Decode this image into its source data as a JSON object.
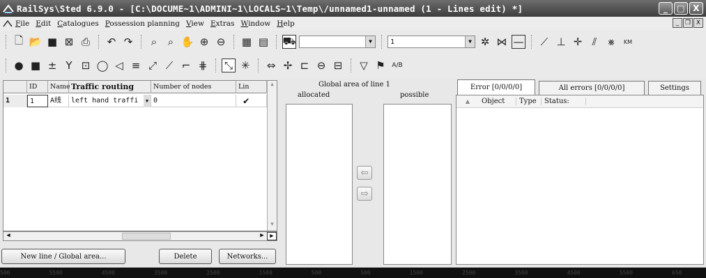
{
  "window": {
    "title": "RailSys\\Sted 6.9.0 - [C:\\DOCUME~1\\ADMINI~1\\LOCALS~1\\Temp\\/unnamed1-unnamed (1 - Lines edit) *]",
    "buttons": {
      "minimize": "_",
      "maximize": "□",
      "close": "X"
    }
  },
  "menu": {
    "items": [
      "File",
      "Edit",
      "Catalogues",
      "Possession planning",
      "View",
      "Extras",
      "Window",
      "Help"
    ],
    "mdi_buttons": {
      "minimize": "_",
      "restore": "❐",
      "close": "X"
    }
  },
  "toolbar1": {
    "combo1_value": "",
    "combo2_value": "1",
    "km_label": "KM"
  },
  "toolbar2": {
    "label_last": "A/B"
  },
  "lines_table": {
    "headers": [
      "ID",
      "Name",
      "Traffic routing",
      "Number of nodes",
      "Lin"
    ],
    "rows": [
      {
        "row_no": "1",
        "id": "1",
        "name": "A线",
        "traffic_routing": "left hand traffi",
        "nodes": "0",
        "line": "✔"
      }
    ]
  },
  "buttons": {
    "new_line": "New line / Global area...",
    "delete": "Delete",
    "networks": "Networks..."
  },
  "global_area": {
    "title": "Global area of line 1",
    "allocated": "allocated",
    "possible": "possible",
    "move_left": "⇦",
    "move_right": "⇨"
  },
  "error_tabs": {
    "tabs": [
      "Error [0/0/0/0]",
      "All errors [0/0/0/0]",
      "Settings"
    ],
    "columns": [
      "Object",
      "Type",
      "Status:"
    ],
    "sort_arrow": "▲"
  },
  "bottom_ruler": [
    "500",
    "5500",
    "4500",
    "3500",
    "2500",
    "1500",
    "500",
    "500",
    "1500",
    "2500",
    "3500",
    "4500",
    "5500",
    "650"
  ]
}
